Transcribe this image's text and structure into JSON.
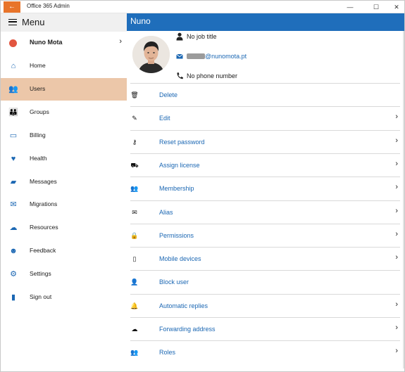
{
  "titlebar": {
    "back_icon": "←",
    "title": "Office 365 Admin",
    "minimize": "—",
    "maximize": "☐",
    "close": "✕"
  },
  "sidebar": {
    "menu_label": "Menu",
    "user": {
      "name": "Nuno Mota",
      "chevron": "›",
      "dot_color": "#e2553f"
    },
    "items": [
      {
        "label": "Home",
        "icon": "home-icon",
        "glyph": "⌂"
      },
      {
        "label": "Users",
        "icon": "users-icon",
        "glyph": "👥",
        "active": true
      },
      {
        "label": "Groups",
        "icon": "groups-icon",
        "glyph": "👪"
      },
      {
        "label": "Billing",
        "icon": "billing-icon",
        "glyph": "▭"
      },
      {
        "label": "Health",
        "icon": "health-icon",
        "glyph": "♥"
      },
      {
        "label": "Messages",
        "icon": "messages-icon",
        "glyph": "▰"
      },
      {
        "label": "Migrations",
        "icon": "migrations-icon",
        "glyph": "✉"
      },
      {
        "label": "Resources",
        "icon": "resources-icon",
        "glyph": "☁"
      },
      {
        "label": "Feedback",
        "icon": "feedback-icon",
        "glyph": "☻"
      },
      {
        "label": "Settings",
        "icon": "settings-icon",
        "glyph": "⚙"
      },
      {
        "label": "Sign out",
        "icon": "sign-out-icon",
        "glyph": "▮"
      }
    ],
    "accent_color": "#1b67b3",
    "active_bg": "#ecc7a9"
  },
  "main": {
    "header_title": "Nuno",
    "header_color": "#1f6ebb",
    "profile": {
      "job_title": "No job title",
      "email": "@nunomota.pt",
      "phone": "No phone number"
    },
    "actions": [
      {
        "label": "Delete",
        "icon": "trash-icon",
        "glyph": "🗑",
        "chevron": false
      },
      {
        "label": "Edit",
        "icon": "pencil-icon",
        "glyph": "✎",
        "chevron": true
      },
      {
        "label": "Reset password",
        "icon": "key-icon",
        "glyph": "⚷",
        "chevron": true
      },
      {
        "label": "Assign license",
        "icon": "license-icon",
        "glyph": "⛟",
        "chevron": true
      },
      {
        "label": "Membership",
        "icon": "membership-icon",
        "glyph": "👥",
        "chevron": true
      },
      {
        "label": "Alias",
        "icon": "mail-icon",
        "glyph": "✉",
        "chevron": true
      },
      {
        "label": "Permissions",
        "icon": "lock-icon",
        "glyph": "🔒",
        "chevron": true
      },
      {
        "label": "Mobile devices",
        "icon": "mobile-icon",
        "glyph": "▯",
        "chevron": true
      },
      {
        "label": "Block user",
        "icon": "block-user-icon",
        "glyph": "👤",
        "chevron": false
      },
      {
        "label": "Automatic replies",
        "icon": "bell-icon",
        "glyph": "🔔",
        "chevron": true
      },
      {
        "label": "Forwarding address",
        "icon": "forward-icon",
        "glyph": "☁",
        "chevron": true
      },
      {
        "label": "Roles",
        "icon": "roles-icon",
        "glyph": "👥",
        "chevron": true
      }
    ],
    "chevron_glyph": "›"
  }
}
